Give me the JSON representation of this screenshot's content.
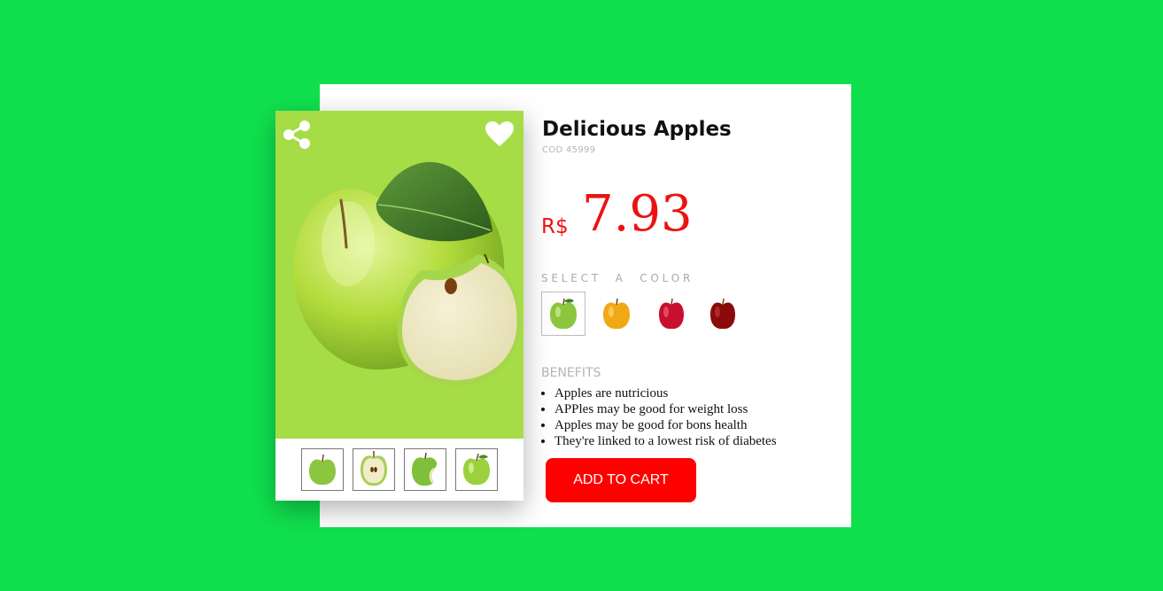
{
  "product": {
    "title": "Delicious Apples",
    "code": "COD  45999",
    "currency": "R$",
    "price": "7.93"
  },
  "gallery": {
    "share_icon": "share-icon",
    "favorite_icon": "heart-icon",
    "thumbnails": [
      "green-apple",
      "apple-half",
      "apple-bitten",
      "green-apple-shiny"
    ]
  },
  "color_select": {
    "label": "SELECT A COLOR",
    "options": [
      {
        "name": "green",
        "color": "#8cc63f",
        "selected": true
      },
      {
        "name": "yellow",
        "color": "#f0a814",
        "selected": false
      },
      {
        "name": "red",
        "color": "#c8102e",
        "selected": false
      },
      {
        "name": "dark-red",
        "color": "#8b0a0a",
        "selected": false
      }
    ]
  },
  "benefits": {
    "label": "BENEFITS",
    "items": [
      "Apples are nutricious",
      "APPles may be good for weight loss",
      "Apples may be good for bons health",
      "They're linked to a lowest risk of diabetes"
    ]
  },
  "cart": {
    "label": "ADD TO CART"
  },
  "colors": {
    "background": "#10e04e",
    "image_background": "#a6dc45",
    "accent": "#ff0000"
  }
}
